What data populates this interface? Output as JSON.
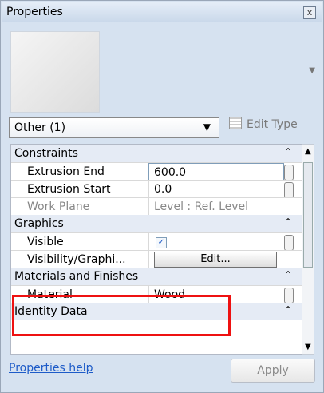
{
  "window": {
    "title": "Properties",
    "close_glyph": "x"
  },
  "type_selector": {
    "label": "Other (1)",
    "edit_type_label": "Edit Type"
  },
  "groups": {
    "constraints": "Constraints",
    "graphics": "Graphics",
    "materials": "Materials and Finishes",
    "identity": "Identity Data"
  },
  "properties": {
    "extrusion_end": {
      "name": "Extrusion End",
      "value": "600.0"
    },
    "extrusion_start": {
      "name": "Extrusion Start",
      "value": "0.0"
    },
    "work_plane": {
      "name": "Work Plane",
      "value": "Level : Ref. Level"
    },
    "visible": {
      "name": "Visible",
      "checked": true
    },
    "visibility": {
      "name": "Visibility/Graphi...",
      "button_label": "Edit..."
    },
    "material": {
      "name": "Material",
      "value": "Wood"
    }
  },
  "footer": {
    "help_link": "Properties help",
    "apply_label": "Apply"
  },
  "colors": {
    "link": "#1d5bc8",
    "highlight": "#e11111"
  }
}
